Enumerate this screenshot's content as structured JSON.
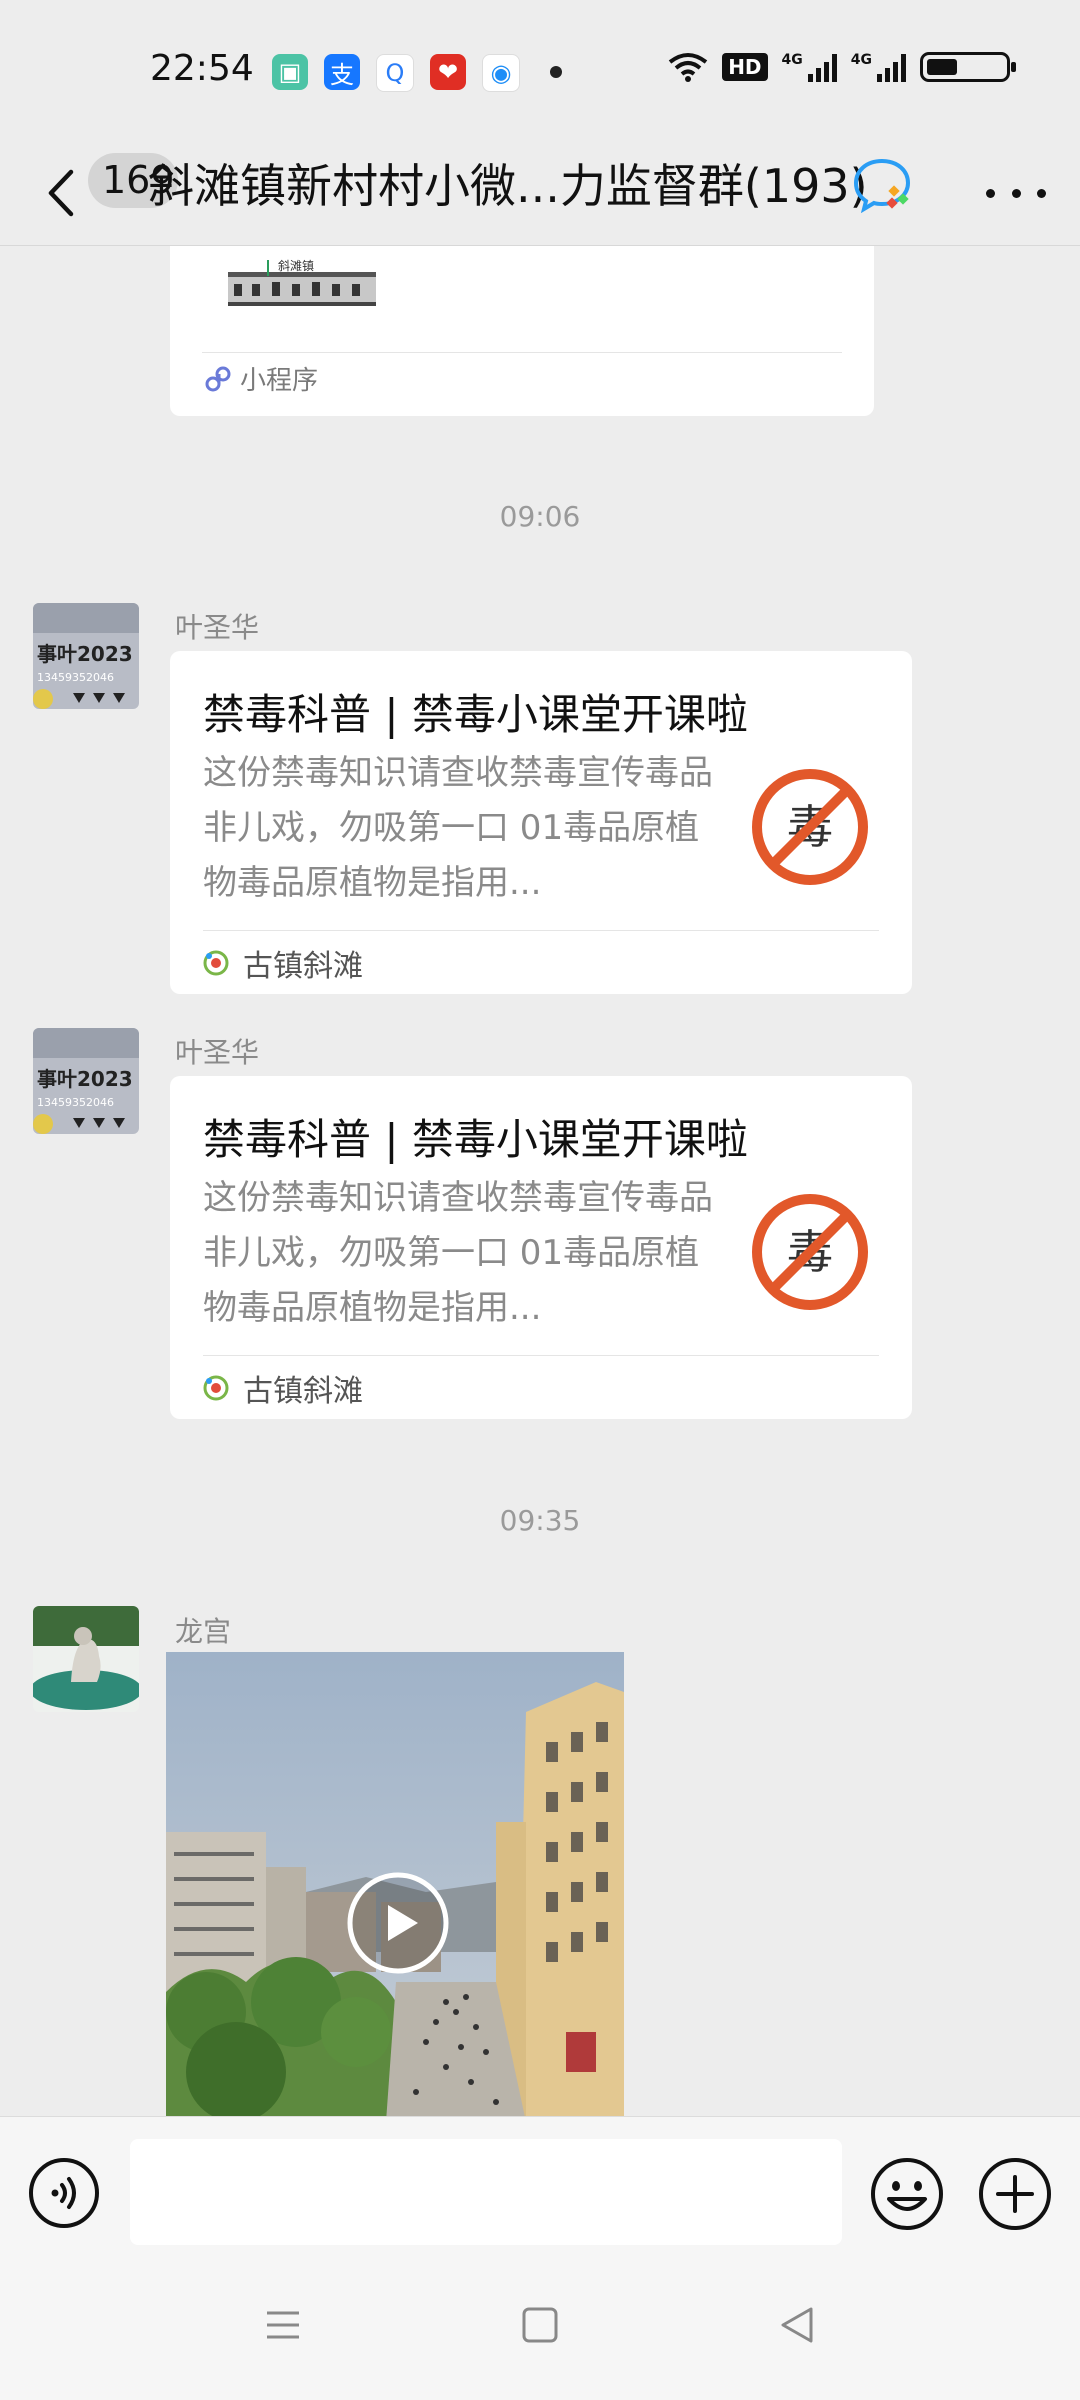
{
  "status_bar": {
    "time": "22:54",
    "hd_label": "HD",
    "signal_1_label": "4G",
    "signal_2_label": "4G",
    "battery_level_percent": 40
  },
  "nav": {
    "unread_count": "169",
    "title": "斜滩镇新村村小微...力监督群(193)"
  },
  "messages": {
    "mini_program": {
      "thumb_text": "斜滩镇",
      "footer_label": "小程序"
    },
    "time_1": "09:06",
    "article_1": {
      "sender": "叶圣华",
      "title": "禁毒科普 | 禁毒小课堂开课啦",
      "description": "这份禁毒知识请查收禁毒宣传毒品非儿戏，勿吸第一口 01毒品原植物毒品原植物是指用...",
      "thumb_char": "毒",
      "source": "古镇斜滩"
    },
    "article_2": {
      "sender": "叶圣华",
      "title": "禁毒科普 | 禁毒小课堂开课啦",
      "description": "这份禁毒知识请查收禁毒宣传毒品非儿戏，勿吸第一口 01毒品原植物毒品原植物是指用...",
      "thumb_char": "毒",
      "source": "古镇斜滩"
    },
    "time_2": "09:35",
    "video": {
      "sender": "龙宫"
    }
  },
  "avatar_text": {
    "line1": "事叶2023",
    "line2": "13459352046"
  },
  "input": {
    "placeholder": ""
  },
  "colors": {
    "background": "#ededed",
    "card": "#ffffff",
    "no_sign": "#e2582a"
  }
}
